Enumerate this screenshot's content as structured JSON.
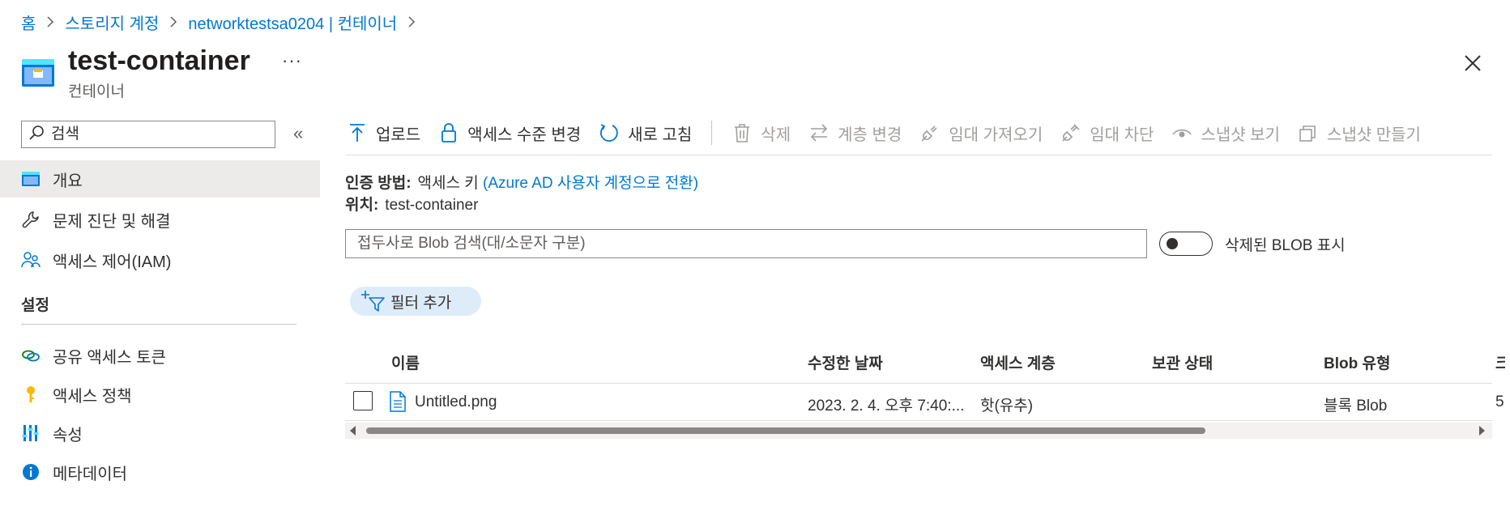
{
  "breadcrumb": [
    "홈",
    "스토리지 계정",
    "networktestsa0204 | 컨테이너"
  ],
  "header": {
    "title": "test-container",
    "subtitle": "컨테이너",
    "more": "···"
  },
  "nav": {
    "search_placeholder": "검색",
    "collapse": "«",
    "items": [
      {
        "label": "개요",
        "icon": "container-icon"
      },
      {
        "label": "문제 진단 및 해결",
        "icon": "wrench-icon"
      },
      {
        "label": "액세스 제어(IAM)",
        "icon": "people-icon"
      }
    ],
    "section_title": "설정",
    "settings_items": [
      {
        "label": "공유 액세스 토큰",
        "icon": "link-icon"
      },
      {
        "label": "액세스 정책",
        "icon": "key-icon"
      },
      {
        "label": "속성",
        "icon": "properties-icon"
      },
      {
        "label": "메타데이터",
        "icon": "info-icon"
      }
    ]
  },
  "toolbar": {
    "upload": "업로드",
    "change_access": "액세스 수준 변경",
    "refresh": "새로 고침",
    "delete": "삭제",
    "change_tier": "계층 변경",
    "acquire_lease": "임대 가져오기",
    "break_lease": "임대 차단",
    "view_snapshots": "스냅샷 보기",
    "create_snapshot": "스냅샷 만들기"
  },
  "info": {
    "auth_label": "인증 방법:",
    "auth_value": "액세스 키",
    "auth_link": "(Azure AD 사용자 계정으로 전환)",
    "location_label": "위치:",
    "location_value": "test-container"
  },
  "filter": {
    "prefix_placeholder": "접두사로 Blob 검색(대/소문자 구분)",
    "toggle_label": "삭제된 BLOB 표시",
    "toggle_on": false,
    "add_filter": "필터 추가"
  },
  "table": {
    "columns": [
      "이름",
      "수정한 날짜",
      "액세스 계층",
      "보관 상태",
      "Blob 유형",
      "크"
    ],
    "rows": [
      {
        "name": "Untitled.png",
        "modified": "2023. 2. 4. 오후 7:40:...",
        "tier": "핫(유추)",
        "archive": "",
        "blob_type": "블록 Blob",
        "size": "5"
      }
    ]
  },
  "colors": {
    "accent": "#0078d4",
    "text": "#323130",
    "disabled": "#a19f9d",
    "active_nav": "#edebe9",
    "pill": "#deecf9"
  }
}
